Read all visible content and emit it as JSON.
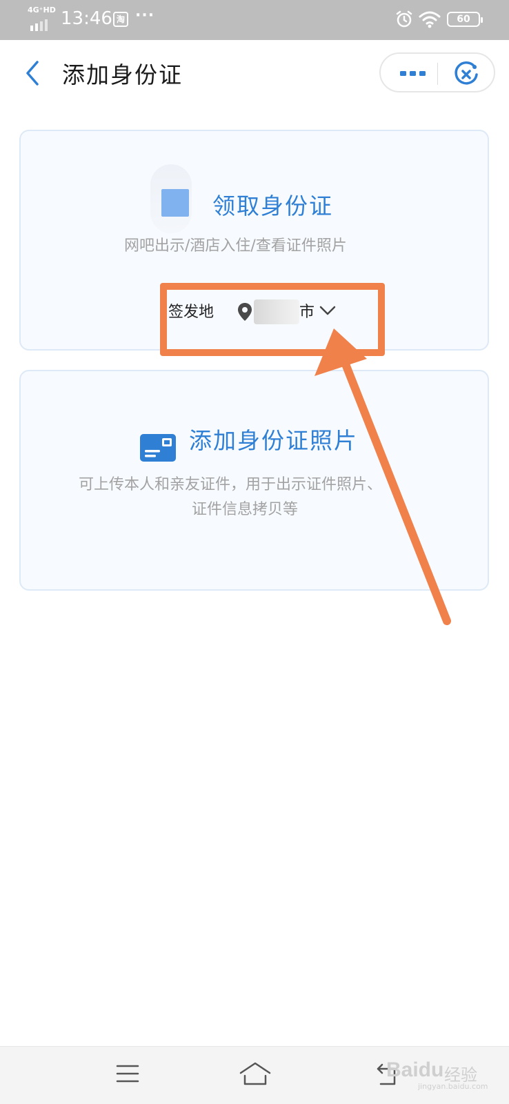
{
  "status_bar": {
    "network": "4G⁺HD",
    "time": "13:46",
    "taobao_badge": "淘",
    "more": "···",
    "battery": "60",
    "icons": [
      "signal-icon",
      "taobao-icon",
      "alarm-icon",
      "wifi-icon",
      "battery-icon"
    ]
  },
  "header": {
    "title": "添加身份证",
    "back_icon": "chevron-left-icon",
    "menu_icon": "more-icon",
    "close_icon": "close-icon"
  },
  "card_receive": {
    "title": "领取身份证",
    "subtitle": "网吧出示/酒店入住/查看证件照片",
    "issue_label": "签发地",
    "city_suffix": "市",
    "pin_icon": "location-pin-icon",
    "dropdown_icon": "chevron-down-icon"
  },
  "card_photo": {
    "title": "添加身份证照片",
    "subtitle_line1": "可上传本人和亲友证件，用于出示证件照片、",
    "subtitle_line2": "证件信息拷贝等",
    "icon": "id-card-icon"
  },
  "nav_bar": {
    "icons": [
      "menu-icon",
      "home-icon",
      "back-icon"
    ]
  },
  "watermark": {
    "brand": "Baidu",
    "cn": "经验",
    "url": "jingyan.baidu.com"
  },
  "colors": {
    "accent": "#2f7fd4",
    "annotation": "#f0814a",
    "status_bar": "#bdbdbd",
    "card_border": "#dde9f6"
  }
}
